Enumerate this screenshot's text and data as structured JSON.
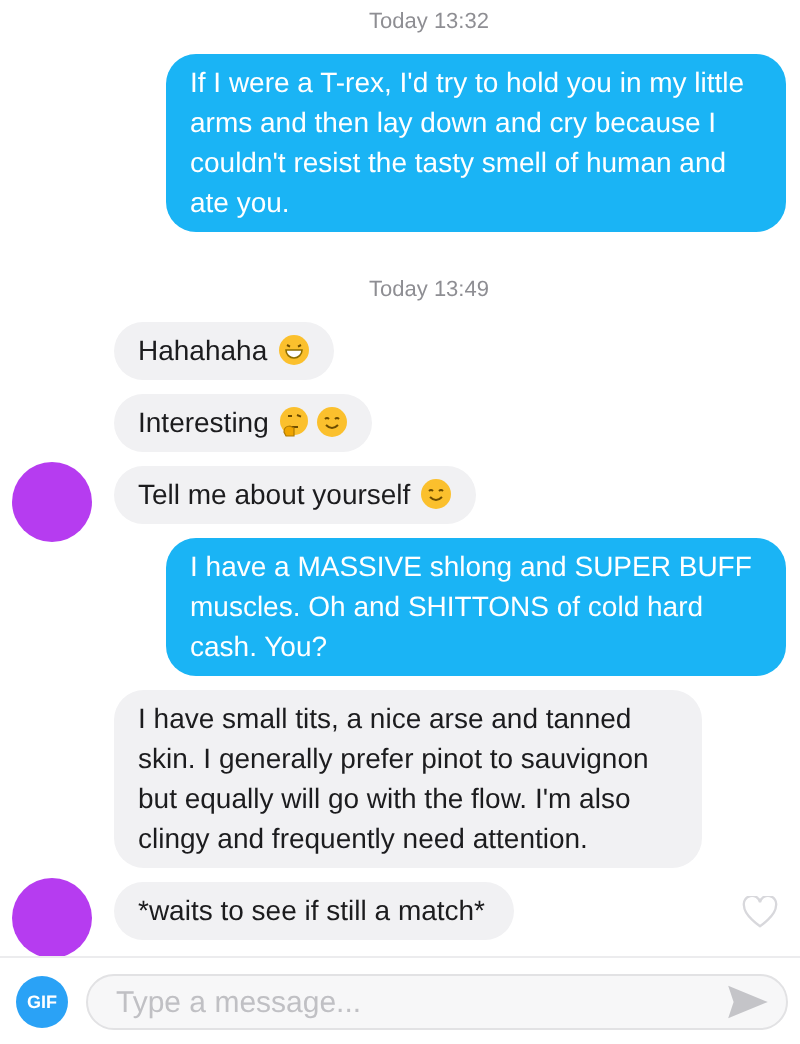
{
  "messages": [
    {
      "kind": "time",
      "text": "Today 13:32"
    },
    {
      "kind": "sent",
      "text": "If I were a T-rex, I'd try to hold you in my little arms and then lay down and cry because I couldn't resist the tasty smell of human and ate you."
    },
    {
      "kind": "time",
      "text": "Today 13:49"
    },
    {
      "kind": "received",
      "text": "Hahahaha",
      "emoji": [
        {
          "kind": "grin"
        }
      ],
      "avatar": false
    },
    {
      "kind": "received",
      "text": "Interesting",
      "emoji": [
        {
          "kind": "think"
        },
        {
          "kind": "smile"
        }
      ],
      "avatar": false
    },
    {
      "kind": "received",
      "text": "Tell me about yourself",
      "emoji": [
        {
          "kind": "smile"
        }
      ],
      "avatar": true
    },
    {
      "kind": "sent",
      "text": "I have a MASSIVE shlong and SUPER BUFF muscles. Oh and SHITTONS of cold hard cash. You?"
    },
    {
      "kind": "received",
      "text": "I have small tits, a nice arse and tanned skin. I generally prefer pinot to sauvignon but equally will go with the flow. I'm also clingy and frequently need attention.",
      "avatar": false
    },
    {
      "kind": "received",
      "text": "*waits to see if still a match*",
      "avatar": true,
      "liked": false
    }
  ],
  "composer": {
    "gif_label": "GIF",
    "placeholder": "Type a message..."
  }
}
